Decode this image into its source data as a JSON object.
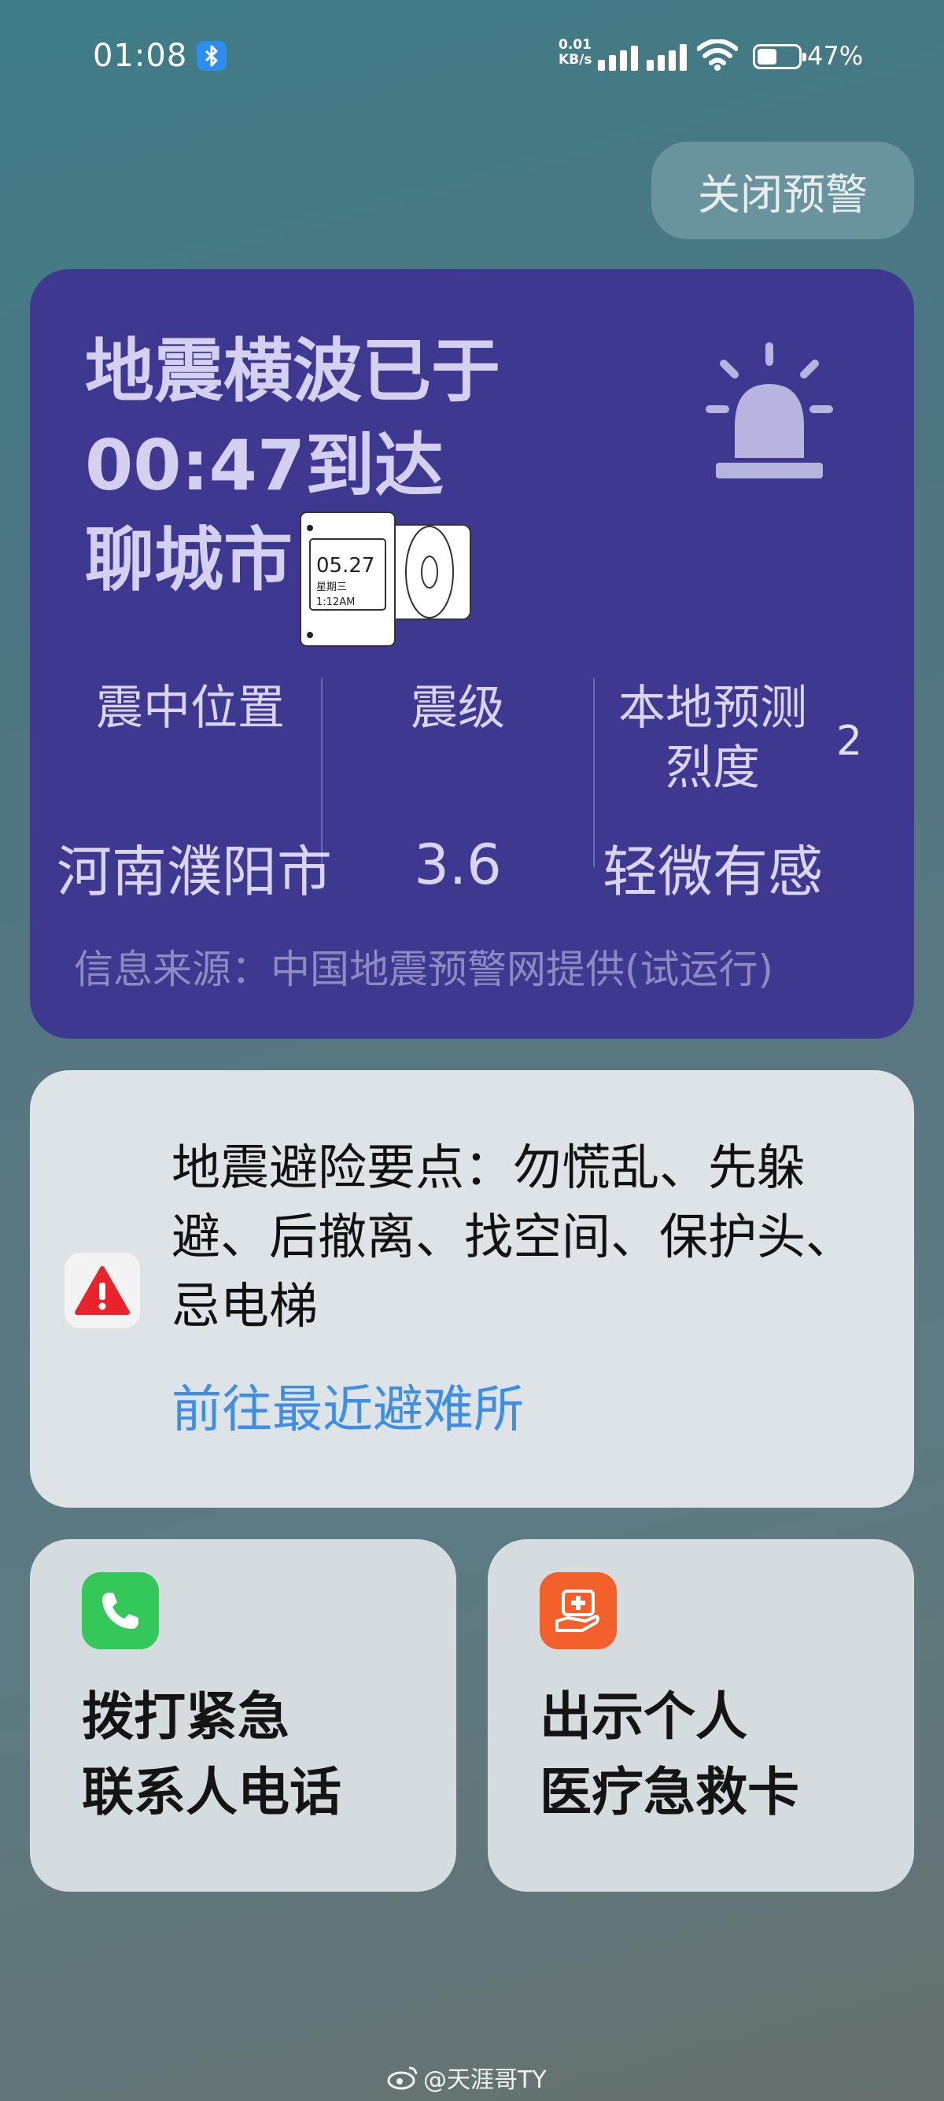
{
  "status_bar": {
    "time": "01:08",
    "net_speed_value": "0.01",
    "net_speed_unit": "KB/s",
    "battery_percent": "47%",
    "battery_level": 0.47
  },
  "close_button": {
    "label": "关闭预警"
  },
  "alert": {
    "title_line1": "地震横波已于",
    "title_line2": "00:47到达",
    "title_line3": "聊城市",
    "sticker": {
      "date": "05.27",
      "weekday": "星期三",
      "time": "1:12AM"
    },
    "columns": [
      {
        "label": "震中位置",
        "value": "河南濮阳市"
      },
      {
        "label": "震级",
        "value": "3.6"
      },
      {
        "label": "本地预测烈度",
        "value": "轻微有感"
      }
    ],
    "intensity_number": "2",
    "source": "信息来源：中国地震预警网提供(试运行)"
  },
  "tips": {
    "text": "地震避险要点：勿慌乱、先躲避、后撤离、找空间、保护头、忌电梯",
    "link": "前往最近避难所"
  },
  "actions": [
    {
      "label_line1": "拨打紧急",
      "label_line2": "联系人电话",
      "icon": "phone-icon",
      "color": "#34c759"
    },
    {
      "label_line1": "出示个人",
      "label_line2": "医疗急救卡",
      "icon": "medical-card-icon",
      "color": "#f4602c"
    }
  ],
  "watermark": "@天涯哥TY",
  "colors": {
    "alert_bg": "#3f3891",
    "link": "#3e8ee3"
  }
}
